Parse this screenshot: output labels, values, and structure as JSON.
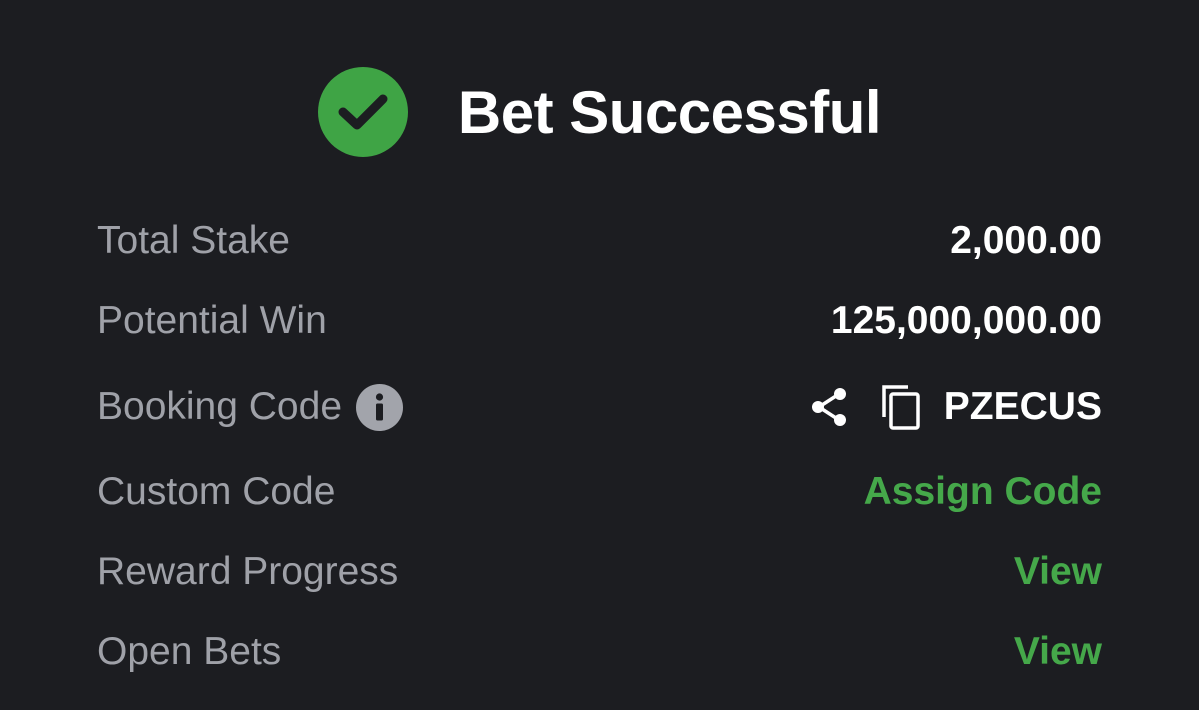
{
  "header": {
    "title": "Bet Successful",
    "icon": "check-circle-icon",
    "accent_color": "#3fa445"
  },
  "rows": [
    {
      "label": "Total Stake",
      "value": "2,000.00"
    },
    {
      "label": "Potential Win",
      "value": "125,000,000.00"
    },
    {
      "label": "Booking Code",
      "value": "PZECUS",
      "label_icon": "info-icon",
      "value_icons": [
        "share-icon",
        "copy-icon"
      ]
    },
    {
      "label": "Custom Code",
      "value": "Assign Code"
    },
    {
      "label": "Reward Progress",
      "value": "View"
    },
    {
      "label": "Open Bets",
      "value": "View"
    }
  ],
  "colors": {
    "background": "#1c1d21",
    "label": "#9fa1a8",
    "value": "#ffffff",
    "link": "#45a84a"
  }
}
